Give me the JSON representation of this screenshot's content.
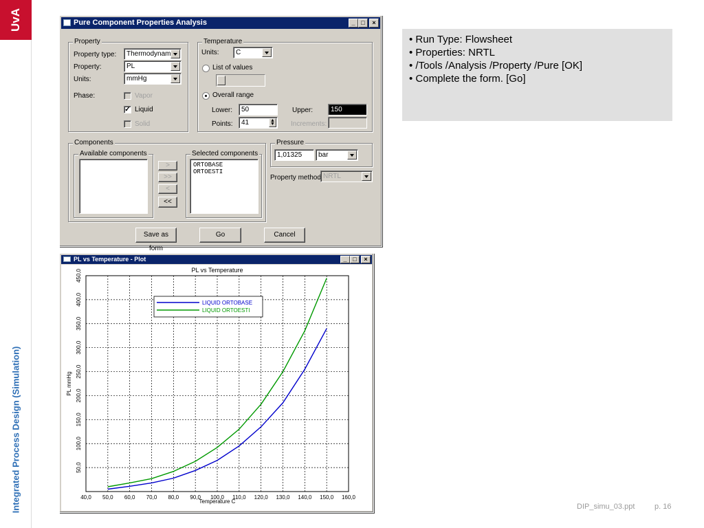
{
  "sidebar": {
    "logo": "UvA",
    "vertical_title": "Integrated Process Design (Simulation)"
  },
  "dialog": {
    "title": "Pure Component Properties Analysis",
    "window_buttons": {
      "minimize": "_",
      "maximize": "□",
      "close": "×"
    },
    "property_group": "Property",
    "property_type_label": "Property type:",
    "property_type_value": "Thermodynamic",
    "property_label": "Property:",
    "property_value": "PL",
    "units_label": "Units:",
    "units_value": "mmHg",
    "phase_label": "Phase:",
    "phase_vapor": "Vapor",
    "phase_liquid": "Liquid",
    "phase_solid": "Solid",
    "phase_liquid_checked": "✓",
    "temperature_group": "Temperature",
    "temp_units_label": "Units:",
    "temp_units_value": "C",
    "list_of_values": "List of values",
    "overall_range": "Overall range",
    "lower_label": "Lower:",
    "lower_value": "50",
    "upper_label": "Upper:",
    "upper_value": "150",
    "points_label": "Points:",
    "points_value": "41",
    "increments_label": "Increments:",
    "components_group": "Components",
    "available_components": "Available components",
    "selected_components": "Selected components",
    "selected_items": [
      "ORTOBASE",
      "ORTOESTI"
    ],
    "move_buttons": [
      ">",
      ">>",
      "<",
      "<<"
    ],
    "pressure_group": "Pressure",
    "pressure_value": "1,01325",
    "pressure_units": "bar",
    "property_method_label": "Property method:",
    "property_method_value": "NRTL",
    "save_as_form": "Save as form",
    "go": "Go",
    "cancel": "Cancel"
  },
  "plot_window": {
    "title": "PL vs Temperature - Plot",
    "window_buttons": {
      "minimize": "_",
      "maximize": "□",
      "close": "×"
    }
  },
  "chart_data": {
    "type": "line",
    "title": "PL vs Temperature",
    "xlabel": "Temperature  C",
    "ylabel": "PL  mmHg",
    "xlim": [
      40,
      160
    ],
    "ylim": [
      0,
      450
    ],
    "x_ticks": [
      "40,0",
      "50,0",
      "60,0",
      "70,0",
      "80,0",
      "90,0",
      "100,0",
      "110,0",
      "120,0",
      "130,0",
      "140,0",
      "150,0",
      "160,0"
    ],
    "y_ticks": [
      "50,0",
      "100,0",
      "150,0",
      "200,0",
      "250,0",
      "300,0",
      "350,0",
      "400,0",
      "450,0"
    ],
    "grid": true,
    "legend_position": "top-center",
    "x": [
      50,
      60,
      70,
      80,
      90,
      100,
      110,
      120,
      130,
      140,
      150
    ],
    "series": [
      {
        "name": "LIQUID ORTOBASE",
        "color": "#0000cc",
        "values": [
          5,
          11,
          18,
          28,
          44,
          65,
          95,
          135,
          185,
          255,
          340
        ]
      },
      {
        "name": "LIQUID ORTOESTI",
        "color": "#009900",
        "values": [
          10,
          18,
          27,
          42,
          63,
          92,
          130,
          182,
          250,
          335,
          445
        ]
      }
    ]
  },
  "bullets": [
    "• Run Type: Flowsheet",
    "• Properties: NRTL",
    "• /Tools /Analysis /Property /Pure    [OK]",
    "• Complete the form.     [Go]"
  ],
  "footer": {
    "file": "DIP_simu_03.ppt",
    "page": "p. 16"
  }
}
